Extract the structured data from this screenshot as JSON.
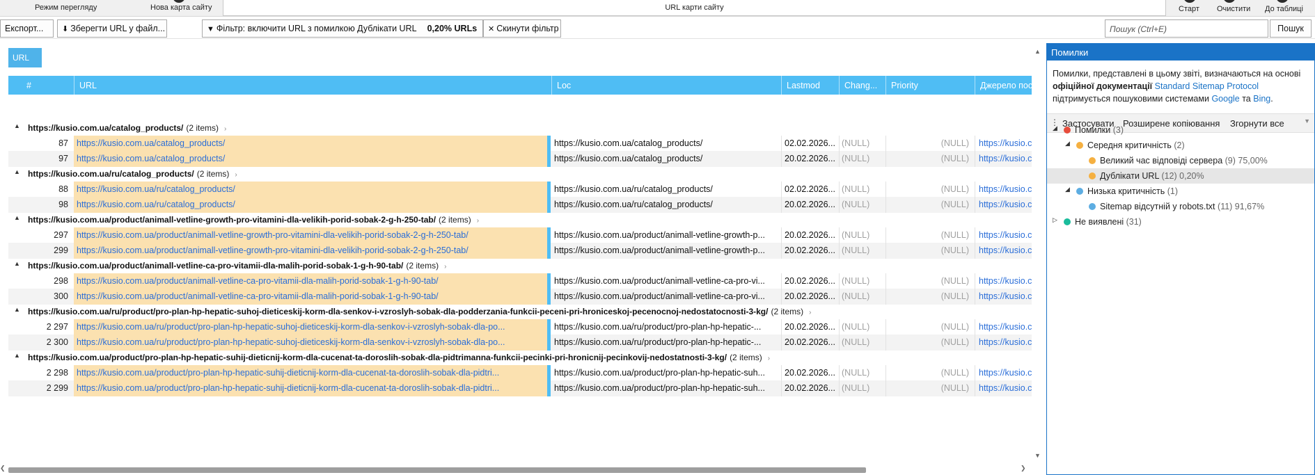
{
  "topbar": {
    "mode_label": "Режим перегляду",
    "new_sitemap_label": "Нова карта сайту",
    "url_field_label": "URL карти сайту",
    "start_label": "Старт",
    "clear_label": "Очистити",
    "to_table_label": "До таблиці"
  },
  "toolbar": {
    "export_label": "Експорт...",
    "save_url_label": "Зберегти URL у файл...",
    "filter_label": "Фільтр: включити URL з помилкою Дублікати URL",
    "filter_percent": "0,20% URLs",
    "reset_filter_label": "Скинути фільтр",
    "search_placeholder": "Пошук (Ctrl+E)",
    "search_button_label": "Пошук"
  },
  "grid": {
    "tab_label": "URL",
    "columns": [
      "#",
      "URL",
      "Loc",
      "Lastmod",
      "Chang...",
      "Priority",
      "Джерело пос"
    ],
    "groups": [
      {
        "url": "https://kusio.com.ua/catalog_products/",
        "count": "(2 items)",
        "rows": [
          {
            "num": "87",
            "url": "https://kusio.com.ua/catalog_products/",
            "loc": "https://kusio.com.ua/catalog_products/",
            "lastmod": "02.02.2026...",
            "chang": "(NULL)",
            "prio": "(NULL)",
            "src": "https://kusio.com"
          },
          {
            "num": "97",
            "url": "https://kusio.com.ua/catalog_products/",
            "loc": "https://kusio.com.ua/catalog_products/",
            "lastmod": "20.02.2026...",
            "chang": "(NULL)",
            "prio": "(NULL)",
            "src": "https://kusio.com"
          }
        ]
      },
      {
        "url": "https://kusio.com.ua/ru/catalog_products/",
        "count": "(2 items)",
        "rows": [
          {
            "num": "88",
            "url": "https://kusio.com.ua/ru/catalog_products/",
            "loc": "https://kusio.com.ua/ru/catalog_products/",
            "lastmod": "02.02.2026...",
            "chang": "(NULL)",
            "prio": "(NULL)",
            "src": "https://kusio.com"
          },
          {
            "num": "98",
            "url": "https://kusio.com.ua/ru/catalog_products/",
            "loc": "https://kusio.com.ua/ru/catalog_products/",
            "lastmod": "20.02.2026...",
            "chang": "(NULL)",
            "prio": "(NULL)",
            "src": "https://kusio.com"
          }
        ]
      },
      {
        "url": "https://kusio.com.ua/product/animall-vetline-growth-pro-vitamini-dla-velikih-porid-sobak-2-g-h-250-tab/",
        "count": "(2 items)",
        "rows": [
          {
            "num": "297",
            "url": "https://kusio.com.ua/product/animall-vetline-growth-pro-vitamini-dla-velikih-porid-sobak-2-g-h-250-tab/",
            "loc": "https://kusio.com.ua/product/animall-vetline-growth-p...",
            "lastmod": "20.02.2026...",
            "chang": "(NULL)",
            "prio": "(NULL)",
            "src": "https://kusio.com"
          },
          {
            "num": "299",
            "url": "https://kusio.com.ua/product/animall-vetline-growth-pro-vitamini-dla-velikih-porid-sobak-2-g-h-250-tab/",
            "loc": "https://kusio.com.ua/product/animall-vetline-growth-p...",
            "lastmod": "20.02.2026...",
            "chang": "(NULL)",
            "prio": "(NULL)",
            "src": "https://kusio.com"
          }
        ]
      },
      {
        "url": "https://kusio.com.ua/product/animall-vetline-ca-pro-vitamii-dla-malih-porid-sobak-1-g-h-90-tab/",
        "count": "(2 items)",
        "rows": [
          {
            "num": "298",
            "url": "https://kusio.com.ua/product/animall-vetline-ca-pro-vitamii-dla-malih-porid-sobak-1-g-h-90-tab/",
            "loc": "https://kusio.com.ua/product/animall-vetline-ca-pro-vi...",
            "lastmod": "20.02.2026...",
            "chang": "(NULL)",
            "prio": "(NULL)",
            "src": "https://kusio.com"
          },
          {
            "num": "300",
            "url": "https://kusio.com.ua/product/animall-vetline-ca-pro-vitamii-dla-malih-porid-sobak-1-g-h-90-tab/",
            "loc": "https://kusio.com.ua/product/animall-vetline-ca-pro-vi...",
            "lastmod": "20.02.2026...",
            "chang": "(NULL)",
            "prio": "(NULL)",
            "src": "https://kusio.com"
          }
        ]
      },
      {
        "url": "https://kusio.com.ua/ru/product/pro-plan-hp-hepatic-suhoj-dieticeskij-korm-dla-senkov-i-vzroslyh-sobak-dla-podderzania-funkcii-peceni-pri-hroniceskoj-pecenocnoj-nedostatocnosti-3-kg/",
        "count": "(2 items)",
        "rows": [
          {
            "num": "2 297",
            "url": "https://kusio.com.ua/ru/product/pro-plan-hp-hepatic-suhoj-dieticeskij-korm-dla-senkov-i-vzroslyh-sobak-dla-po...",
            "loc": "https://kusio.com.ua/ru/product/pro-plan-hp-hepatic-...",
            "lastmod": "20.02.2026...",
            "chang": "(NULL)",
            "prio": "(NULL)",
            "src": "https://kusio.com"
          },
          {
            "num": "2 300",
            "url": "https://kusio.com.ua/ru/product/pro-plan-hp-hepatic-suhoj-dieticeskij-korm-dla-senkov-i-vzroslyh-sobak-dla-po...",
            "loc": "https://kusio.com.ua/ru/product/pro-plan-hp-hepatic-...",
            "lastmod": "20.02.2026...",
            "chang": "(NULL)",
            "prio": "(NULL)",
            "src": "https://kusio.com"
          }
        ]
      },
      {
        "url": "https://kusio.com.ua/product/pro-plan-hp-hepatic-suhij-dieticnij-korm-dla-cucenat-ta-doroslih-sobak-dla-pidtrimanna-funkcii-pecinki-pri-hronicnij-pecinkovij-nedostatnosti-3-kg/",
        "count": "(2 items)",
        "rows": [
          {
            "num": "2 298",
            "url": "https://kusio.com.ua/product/pro-plan-hp-hepatic-suhij-dieticnij-korm-dla-cucenat-ta-doroslih-sobak-dla-pidtri...",
            "loc": "https://kusio.com.ua/product/pro-plan-hp-hepatic-suh...",
            "lastmod": "20.02.2026...",
            "chang": "(NULL)",
            "prio": "(NULL)",
            "src": "https://kusio.com"
          },
          {
            "num": "2 299",
            "url": "https://kusio.com.ua/product/pro-plan-hp-hepatic-suhij-dieticnij-korm-dla-cucenat-ta-doroslih-sobak-dla-pidtri...",
            "loc": "https://kusio.com.ua/product/pro-plan-hp-hepatic-suh...",
            "lastmod": "20.02.2026...",
            "chang": "(NULL)",
            "prio": "(NULL)",
            "src": "https://kusio.com"
          }
        ]
      }
    ]
  },
  "panel": {
    "title": "Помилки",
    "desc_1": "Помилки, представлені в цьому звіті, визначаються на основі ",
    "desc_bold": "офіційної документації",
    "desc_link": "Standard Sitemap Protocol",
    "desc_2": "підтримується пошуковими системами ",
    "desc_google": "Google",
    "desc_and": " та ",
    "desc_bing": "Bing",
    "desc_end": ".",
    "apply_label": "Застосувати",
    "adv_copy_label": "Розширене копіювання",
    "collapse_label": "Згорнути все",
    "tree": [
      {
        "label": "Помилки",
        "count": "(3)",
        "color": "#e74c3c"
      },
      {
        "label": "Середня критичність",
        "count": "(2)",
        "color": "#f5b041"
      },
      {
        "label": "Великий час відповіді сервера",
        "count": "(9) 75,00%",
        "color": "#f5b041"
      },
      {
        "label": "Дублікати URL",
        "count": "(12) 0,20%",
        "color": "#f5b041"
      },
      {
        "label": "Низька критичність",
        "count": "(1)",
        "color": "#5dade2"
      },
      {
        "label": "Sitemap відсутній у robots.txt",
        "count": "(11) 91,67%",
        "color": "#5dade2"
      },
      {
        "label": "Не виявлені",
        "count": "(31)",
        "color": "#1abc9c"
      }
    ]
  }
}
